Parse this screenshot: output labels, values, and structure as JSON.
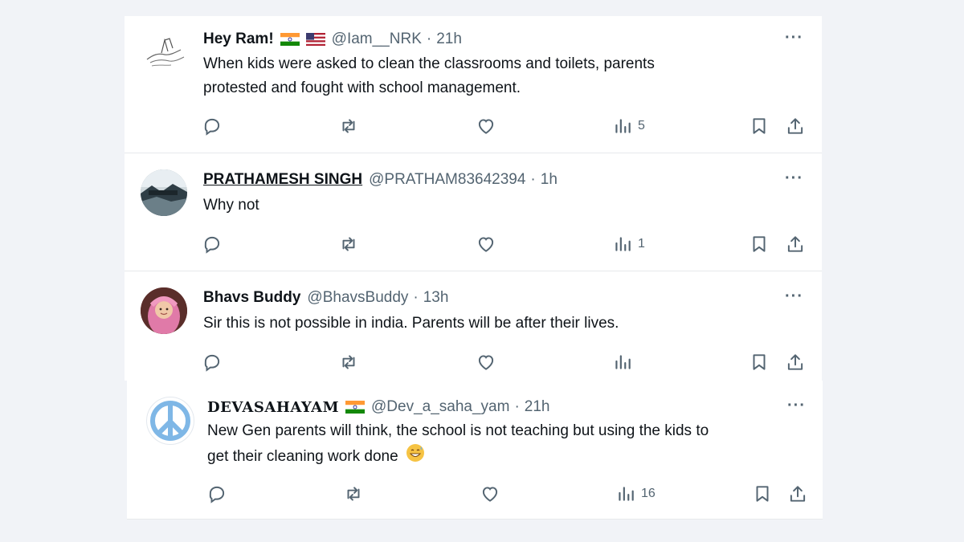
{
  "tweets": [
    {
      "name": "Hey Ram!",
      "flags": [
        "india-flag",
        "us-flag"
      ],
      "handle": "@Iam__NRK",
      "time": "21h",
      "text_line1": "When kids were asked to clean the classrooms and toilets, parents",
      "text_line2": "protested and fought with school management.",
      "views": "5"
    },
    {
      "name": "PRATHAMESH SINGH",
      "handle": "@PRATHAM83642394",
      "time": "1h",
      "text_line1": "Why not",
      "views": "1"
    },
    {
      "name": "Bhavs Buddy",
      "handle": "@BhavsBuddy",
      "time": "13h",
      "text_line1": "Sir this is not possible in india. Parents will be after their lives.",
      "views": ""
    },
    {
      "name": "DEVASAHAYAM",
      "flags": [
        "india-flag"
      ],
      "handle": "@Dev_a_saha_yam",
      "time": "21h",
      "text_line1": "New Gen parents will think, the school is not teaching but using the kids to",
      "text_line2": "get their cleaning work done",
      "emoji": "grinning-sweat-emoji",
      "views": "16"
    }
  ],
  "separator": "·",
  "more_label": "···",
  "colors": {
    "text": "#0f1419",
    "muted": "#536471",
    "background": "#f1f3f7",
    "card": "#ffffff"
  }
}
